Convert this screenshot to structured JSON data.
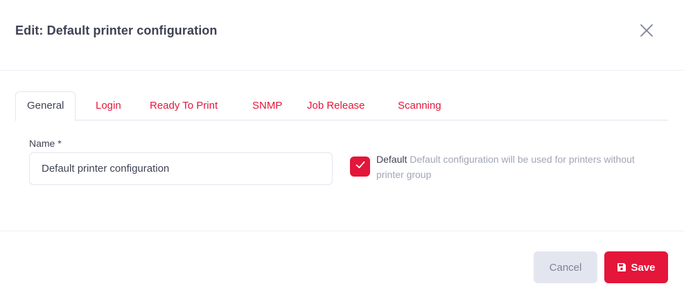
{
  "header": {
    "title": "Edit: Default printer configuration",
    "close_icon": "close-icon"
  },
  "tabs": [
    {
      "label": "General",
      "active": true
    },
    {
      "label": "Login",
      "active": false
    },
    {
      "label": "Ready To Print",
      "active": false
    },
    {
      "label": "SNMP",
      "active": false
    },
    {
      "label": "Job Release",
      "active": false
    },
    {
      "label": "Scanning",
      "active": false
    }
  ],
  "form": {
    "name_label": "Name *",
    "name_value": "Default printer configuration",
    "default_checked": true,
    "default_label": "Default",
    "default_help": "Default configuration will be used for printers without printer group"
  },
  "footer": {
    "cancel_label": "Cancel",
    "save_label": "Save",
    "save_icon": "save-icon"
  },
  "colors": {
    "accent": "#e4163a",
    "text": "#3f4254",
    "muted": "#a1a5b7",
    "cancel_bg": "#e4e6ef"
  }
}
